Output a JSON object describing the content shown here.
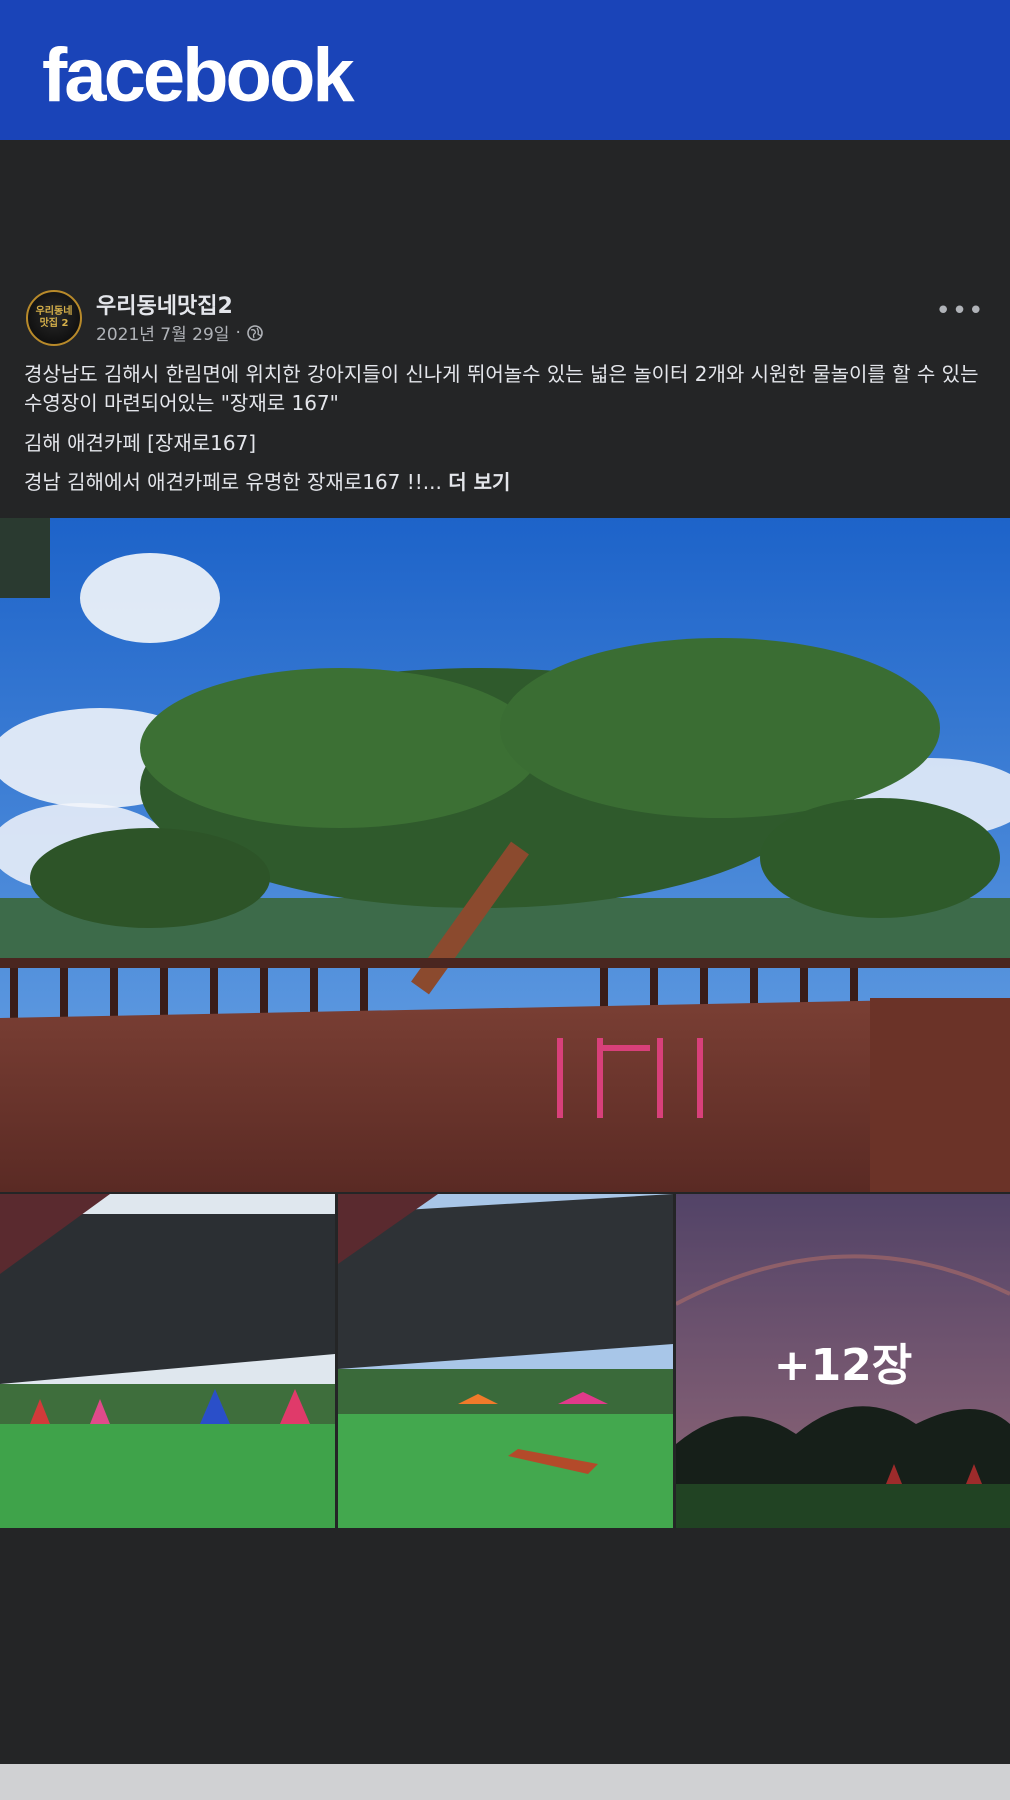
{
  "header": {
    "logo_text": "facebook",
    "color": "#1a44b8"
  },
  "post": {
    "author": "우리동네맛집2",
    "avatar_text_line1": "우리동네",
    "avatar_text_line2": "맛집 2",
    "date": "2021년 7월 29일",
    "separator": "·",
    "privacy_icon": "globe-icon",
    "more_icon": "more-options-icon",
    "text_line1": "경상남도 김해시 한림면에 위치한 강아지들이 신나게 뛰어놀수 있는 넓은 놀이터 2개와 시원한 물놀이를 할 수 있는 수영장이 마련되어있는 \"장재로 167\"",
    "text_line2": "김해 애견카페 [장재로167]",
    "text_line3": "경남 김해에서 애견카페로 유명한 장재로167 !!...",
    "see_more": "더 보기",
    "more_photos_label": "+12장"
  },
  "colors": {
    "background": "#242526",
    "text": "#e4e6eb",
    "secondary_text": "#b0b3b8"
  }
}
